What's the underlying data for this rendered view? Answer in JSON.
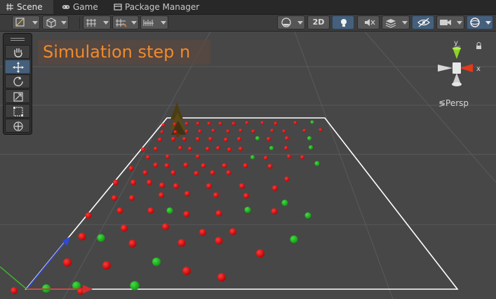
{
  "tabs": [
    {
      "label": "Scene",
      "icon": "scene-grid-icon",
      "active": true
    },
    {
      "label": "Game",
      "icon": "gamepad-icon",
      "active": false
    },
    {
      "label": "Package Manager",
      "icon": "package-icon",
      "active": false
    }
  ],
  "toolbar": {
    "mode_2d_label": "2D"
  },
  "tools": [
    "hand-tool",
    "move-tool",
    "rotate-tool",
    "scale-tool",
    "rect-tool",
    "transform-tool"
  ],
  "overlay": {
    "title": "Simulation step n"
  },
  "gizmo": {
    "y_label": "y",
    "x_label": "x",
    "projection_label": "≶Persp"
  },
  "colors": {
    "agent_red": "#d40000",
    "agent_green": "#17b217",
    "plane_border": "#ffffff",
    "overlay_text": "#f08a2c"
  }
}
